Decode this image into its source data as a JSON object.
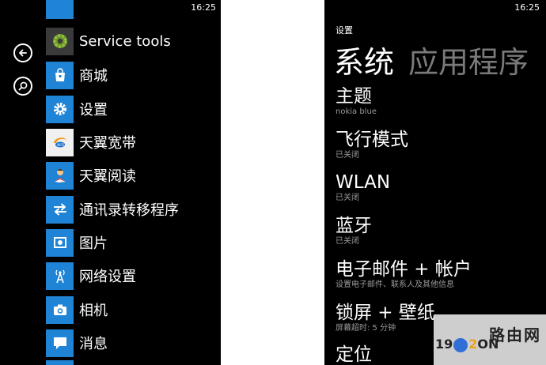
{
  "left_phone": {
    "clock": "16:25",
    "apps": [
      {
        "label": "Service tools",
        "icon": "gear-icon"
      },
      {
        "label": "商城",
        "icon": "store-bag-icon"
      },
      {
        "label": "设置",
        "icon": "settings-gear-icon"
      },
      {
        "label": "天翼宽带",
        "icon": "tianyi-wifi-icon"
      },
      {
        "label": "天翼阅读",
        "icon": "reader-person-icon"
      },
      {
        "label": "通讯录转移程序",
        "icon": "transfer-arrows-icon"
      },
      {
        "label": "图片",
        "icon": "picture-icon"
      },
      {
        "label": "网络设置",
        "icon": "antenna-icon"
      },
      {
        "label": "相机",
        "icon": "camera-icon"
      },
      {
        "label": "消息",
        "icon": "message-bubble-icon"
      }
    ]
  },
  "right_phone": {
    "clock": "16:25",
    "header": "设置",
    "pivots": [
      "系统",
      "应用程序"
    ],
    "settings": [
      {
        "title": "主题",
        "sub": "nokia blue"
      },
      {
        "title": "飞行模式",
        "sub": "已关闭"
      },
      {
        "title": "WLAN",
        "sub": "已关闭"
      },
      {
        "title": "蓝牙",
        "sub": "已关闭"
      },
      {
        "title": "电子邮件 + 帐户",
        "sub": "设置电子邮件、联系人及其他信息"
      },
      {
        "title": "锁屏 + 壁纸",
        "sub": "屏幕超时: 5 分钟"
      },
      {
        "title": "定位",
        "sub": ""
      }
    ]
  },
  "watermark": {
    "top": "路由网",
    "bottom_left": "19",
    "bottom_right": "ON"
  },
  "colors": {
    "tile_blue": "#1f83d6",
    "background": "#000000",
    "subtext": "#9a9a9a",
    "inactive_pivot": "#7a7a7a"
  }
}
